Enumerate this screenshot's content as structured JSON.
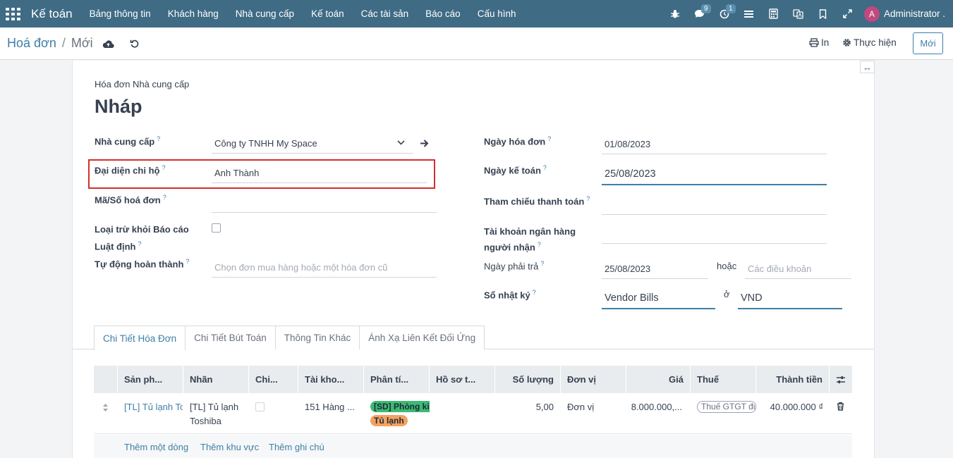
{
  "topbar": {
    "brand": "Kế toán",
    "menu": [
      "Bảng thông tin",
      "Khách hàng",
      "Nhà cung cấp",
      "Kế toán",
      "Các tài sản",
      "Báo cáo",
      "Cấu hình"
    ],
    "chat_badge": "9",
    "activity_badge": "1",
    "avatar_letter": "A",
    "user_name": "Administrator ..."
  },
  "control": {
    "breadcrumb_parent": "Hoá đơn",
    "breadcrumb_sep": "/",
    "breadcrumb_current": "Mới",
    "print_label": "In",
    "action_label": "Thực hiện",
    "new_button": "Mới"
  },
  "form": {
    "subtitle": "Hóa đơn Nhà cung cấp",
    "status_title": "Nháp",
    "left": {
      "vendor_label": "Nhà cung cấp",
      "vendor_value": "Công ty TNHH My Space",
      "agent_label": "Đại diện chi hộ",
      "agent_value": "Anh Thành",
      "invoice_no_label": "Mã/Số hoá đơn",
      "invoice_no_value": "",
      "exclude_label_1": "Loại trừ khỏi Báo cáo",
      "exclude_label_2": "Luật định",
      "autocomplete_label": "Tự động hoàn thành",
      "autocomplete_placeholder": "Chọn đơn mua hàng hoặc một hóa đơn cũ"
    },
    "right": {
      "invoice_date_label": "Ngày hóa đơn",
      "invoice_date_value": "01/08/2023",
      "accounting_date_label": "Ngày kế toán",
      "accounting_date_value": "25/08/2023",
      "payment_ref_label": "Tham chiếu thanh toán",
      "payment_ref_value": "",
      "bank_label_1": "Tài khoản ngân hàng",
      "bank_label_2": "người nhận",
      "bank_value": "",
      "due_date_label": "Ngày phải trả",
      "due_date_value": "25/08/2023",
      "or_text": "hoặc",
      "terms_placeholder": "Các điều khoản",
      "journal_label": "Sổ nhật ký",
      "journal_value": "Vendor Bills",
      "in_text": "ở",
      "currency_value": "VND"
    }
  },
  "tabs": [
    "Chi Tiết Hóa Đơn",
    "Chi Tiết Bút Toán",
    "Thông Tin Khác",
    "Ánh Xạ Liên Kết Đối Ứng"
  ],
  "table": {
    "columns": [
      "Sản ph...",
      "Nhãn",
      "Chi...",
      "Tài kho...",
      "Phân tí...",
      "Hồ sơ t...",
      "Số lượng",
      "Đơn vị",
      "Giá",
      "Thuế",
      "Thành tiền"
    ],
    "row": {
      "product": "[TL] Tủ lạnh To",
      "label_line1": "[TL] Tủ lạnh",
      "label_line2": "Toshiba",
      "account": "151 Hàng ...",
      "analytic_tag_1": "[SD] Phòng kin",
      "analytic_tag_2": "Tủ lạnh",
      "quantity": "5,00",
      "uom": "Đơn vị",
      "price": "8.000.000,...",
      "tax": "Thuế GTGT đư",
      "subtotal": "40.000.000 ₫"
    },
    "add_line": "Thêm một dòng",
    "add_section": "Thêm khu vực",
    "add_note": "Thêm ghi chú"
  },
  "colors": {
    "navbar": "#3f6b85",
    "accent": "#3e7fa8",
    "highlight_box": "#d32f2f",
    "tag_green": "#3cba73",
    "tag_orange": "#f4a261"
  }
}
